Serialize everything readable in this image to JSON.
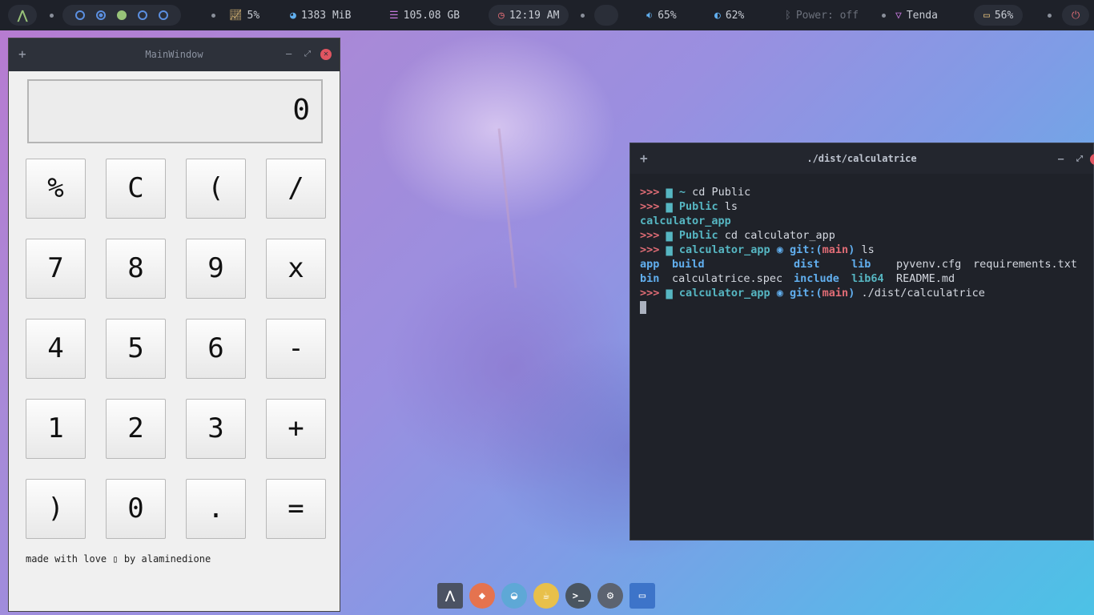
{
  "topbar": {
    "cpu": "5%",
    "memory": "1383 MiB",
    "disk": "105.08 GB",
    "clock": "12:19 AM",
    "volume": "65%",
    "brightness": "62%",
    "bluetooth": "Power: off",
    "wifi": "Tenda",
    "battery": "56%"
  },
  "calculator": {
    "title": "MainWindow",
    "display": "0",
    "keys": [
      "%",
      "C",
      "(",
      "/",
      "7",
      "8",
      "9",
      "x",
      "4",
      "5",
      "6",
      "-",
      "1",
      "2",
      "3",
      "+",
      ")",
      "0",
      ".",
      "="
    ],
    "footer": "made with love ▯ by alaminedione"
  },
  "terminal": {
    "title": "./dist/calculatrice",
    "prompt": ">>>",
    "home": "~",
    "lines": {
      "l1_cmd": "cd Public",
      "l2_dir": "Public",
      "l2_cmd": "ls",
      "l3_out": "calculator_app",
      "l4_dir": "Public",
      "l4_cmd": "cd calculator_app",
      "l5_dir": "calculator_app",
      "l5_git": "git:(",
      "l5_branch": "main",
      "l5_close": ")",
      "l5_cmd": "ls",
      "ls_row1": [
        "app",
        "build",
        "dist",
        "lib",
        "pyvenv.cfg",
        "requirements.txt"
      ],
      "ls_row2": [
        "bin",
        "calculatrice.spec",
        "include",
        "lib64",
        "README.md"
      ],
      "l8_dir": "calculator_app",
      "l8_git": "git:(",
      "l8_branch": "main",
      "l8_close": ")",
      "l8_cmd": "./dist/calculatrice"
    }
  },
  "dock": {
    "items": [
      "arch-launcher",
      "firefox",
      "browser",
      "file-manager",
      "terminal",
      "settings",
      "window"
    ]
  },
  "colors": {
    "close": "#e05561",
    "prompt_red": "#e06c75",
    "prompt_yellow": "#e5c07b",
    "prompt_green": "#98c379",
    "cyan": "#56b6c2",
    "blue": "#61afef"
  }
}
